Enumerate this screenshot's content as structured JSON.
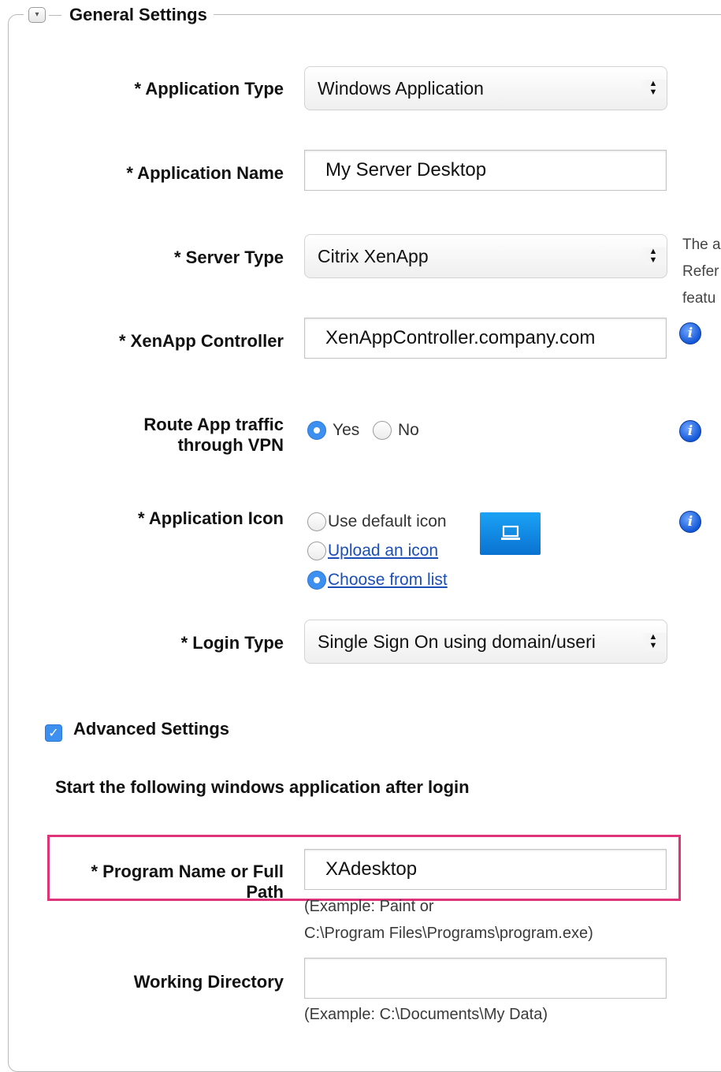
{
  "section": {
    "title": "General Settings",
    "collapse_glyph": "▾"
  },
  "fields": {
    "application_type": {
      "label": "* Application Type",
      "value": "Windows Application"
    },
    "application_name": {
      "label": "* Application Name",
      "value": "My Server Desktop"
    },
    "server_type": {
      "label": "* Server Type",
      "value": "Citrix XenApp",
      "side_note": [
        "The a",
        "Refer",
        "featu"
      ]
    },
    "xenapp_controller": {
      "label": "* XenApp Controller",
      "value": "XenAppController.company.com"
    },
    "route_vpn": {
      "label_line1": "Route App traffic",
      "label_line2": "through VPN",
      "options": [
        "Yes",
        "No"
      ],
      "selected": "Yes"
    },
    "application_icon": {
      "label": "* Application Icon",
      "options": [
        "Use default icon",
        "Upload an icon",
        "Choose from list"
      ],
      "selected": "Choose from list",
      "icon_name": "monitor-icon"
    },
    "login_type": {
      "label": "* Login Type",
      "value": "Single Sign On using domain/useri"
    }
  },
  "advanced": {
    "checkbox_label": "Advanced Settings",
    "checked": true,
    "subheading": "Start the following windows application after login",
    "program": {
      "label_line1": "* Program Name or Full",
      "label_line2": "Path",
      "value": "XAdesktop",
      "hint_line1": "(Example: Paint or",
      "hint_line2": "C:\\Program Files\\Programs\\program.exe)"
    },
    "working_dir": {
      "label": "Working Directory",
      "value": "",
      "hint": "(Example: C:\\Documents\\My Data)"
    }
  },
  "info_glyph": "i",
  "colors": {
    "accent": "#3d8ff0",
    "highlight": "#e0347a",
    "link": "#1c4fb5"
  }
}
